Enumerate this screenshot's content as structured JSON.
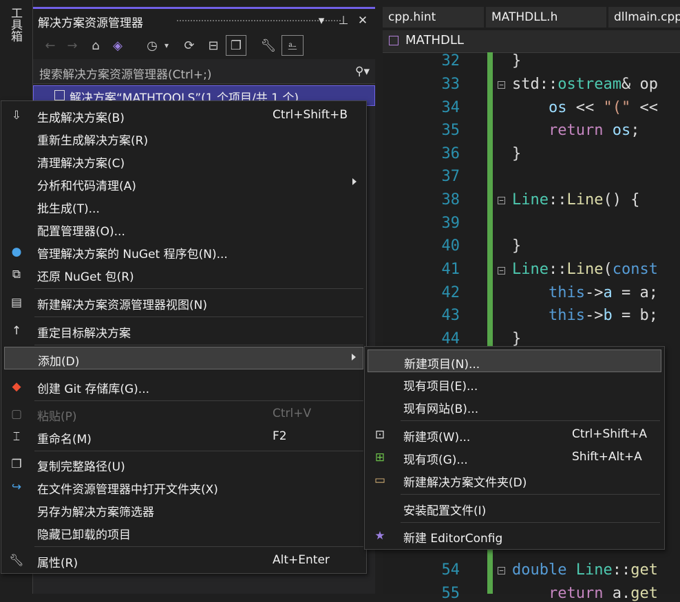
{
  "toolbox": {
    "label": "工具箱"
  },
  "solution_explorer": {
    "title": "解决方案资源管理器",
    "search_placeholder": "搜索解决方案资源管理器(Ctrl+;)",
    "selected_row": "解决方案“MATHTOOLS”(1 个项目/共 1 个)"
  },
  "editor": {
    "tabs": [
      "cpp.hint",
      "MATHDLL.h",
      "dllmain.cpp"
    ],
    "nav_title": "MATHDLL",
    "line_numbers": [
      "32",
      "33",
      "34",
      "35",
      "36",
      "37",
      "38",
      "39",
      "40",
      "41",
      "42",
      "43",
      "44",
      "54",
      "55"
    ]
  },
  "context_menu": {
    "items": [
      {
        "label": "生成解决方案(B)",
        "shortcut": "Ctrl+Shift+B",
        "icon": "build-icon"
      },
      {
        "label": "重新生成解决方案(R)",
        "shortcut": ""
      },
      {
        "label": "清理解决方案(C)",
        "shortcut": ""
      },
      {
        "label": "分析和代码清理(A)",
        "shortcut": "",
        "submenu": true
      },
      {
        "label": "批生成(T)...",
        "shortcut": ""
      },
      {
        "label": "配置管理器(O)...",
        "shortcut": ""
      },
      {
        "label": "管理解决方案的 NuGet 程序包(N)...",
        "shortcut": "",
        "icon": "nuget-icon"
      },
      {
        "label": "还原 NuGet 包(R)",
        "shortcut": "",
        "icon": "restore-icon"
      },
      {
        "label": "新建解决方案资源管理器视图(N)",
        "shortcut": "",
        "icon": "new-view-icon"
      },
      {
        "label": "重定目标解决方案",
        "shortcut": "",
        "icon": "retarget-icon"
      },
      {
        "label": "添加(D)",
        "shortcut": "",
        "submenu": true
      },
      {
        "label": "创建 Git 存储库(G)...",
        "shortcut": "",
        "icon": "git-icon"
      },
      {
        "label": "粘贴(P)",
        "shortcut": "Ctrl+V",
        "icon": "paste-icon",
        "disabled": true
      },
      {
        "label": "重命名(M)",
        "shortcut": "F2",
        "icon": "rename-icon"
      },
      {
        "label": "复制完整路径(U)",
        "shortcut": "",
        "icon": "copy-icon"
      },
      {
        "label": "在文件资源管理器中打开文件夹(X)",
        "shortcut": "",
        "icon": "open-folder-icon"
      },
      {
        "label": "另存为解决方案筛选器",
        "shortcut": ""
      },
      {
        "label": "隐藏已卸载的项目",
        "shortcut": ""
      },
      {
        "label": "属性(R)",
        "shortcut": "Alt+Enter",
        "icon": "wrench-icon"
      }
    ]
  },
  "add_submenu": {
    "items": [
      {
        "label": "新建项目(N)...",
        "shortcut": ""
      },
      {
        "label": "现有项目(E)...",
        "shortcut": ""
      },
      {
        "label": "现有网站(B)...",
        "shortcut": ""
      },
      {
        "label": "新建项(W)...",
        "shortcut": "Ctrl+Shift+A",
        "icon": "new-item-icon"
      },
      {
        "label": "现有项(G)...",
        "shortcut": "Shift+Alt+A",
        "icon": "existing-item-icon"
      },
      {
        "label": "新建解决方案文件夹(D)",
        "shortcut": "",
        "icon": "solution-folder-icon"
      },
      {
        "label": "安装配置文件(I)",
        "shortcut": ""
      },
      {
        "label": "新建 EditorConfig",
        "shortcut": "",
        "icon": "editorconfig-icon"
      }
    ]
  },
  "colors": {
    "accent": "#7160e8",
    "selection": "#3b3a8c",
    "change_bar": "#57a64a"
  }
}
